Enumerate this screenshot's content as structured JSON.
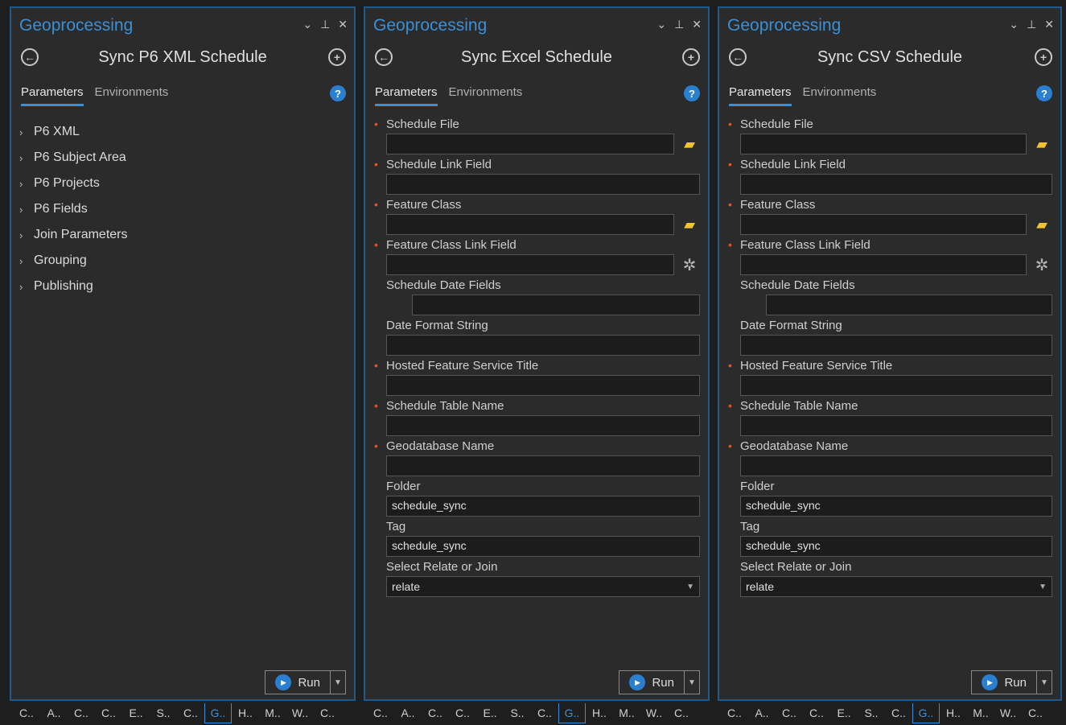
{
  "panes": [
    {
      "title": "Geoprocessing",
      "controls": [
        "⌄",
        "⊥",
        "✕"
      ],
      "tool_title": "Sync P6 XML Schedule",
      "tabs": [
        {
          "label": "Parameters",
          "active": true
        },
        {
          "label": "Environments",
          "active": false
        }
      ],
      "groups": [
        "P6 XML",
        "P6 Subject Area",
        "P6 Projects",
        "P6 Fields",
        "Join Parameters",
        "Grouping",
        "Publishing"
      ],
      "run_label": "Run"
    },
    {
      "title": "Geoprocessing",
      "controls": [
        "⌄",
        "⊥",
        "✕"
      ],
      "tool_title": "Sync Excel Schedule",
      "tabs": [
        {
          "label": "Parameters",
          "active": true
        },
        {
          "label": "Environments",
          "active": false
        }
      ],
      "params": [
        {
          "label": "Schedule File",
          "required": true,
          "value": "",
          "icon": "folder-icon"
        },
        {
          "label": "Schedule Link Field",
          "required": true,
          "value": ""
        },
        {
          "label": "Feature Class",
          "required": true,
          "value": "",
          "icon": "folder-icon"
        },
        {
          "label": "Feature Class Link Field",
          "required": true,
          "value": "",
          "icon": "gear-icon"
        },
        {
          "label": "Schedule Date Fields",
          "required": false,
          "value": "",
          "indent": true
        },
        {
          "label": "Date Format String",
          "required": false,
          "value": ""
        },
        {
          "label": "Hosted Feature Service Title",
          "required": true,
          "value": ""
        },
        {
          "label": "Schedule Table Name",
          "required": true,
          "value": ""
        },
        {
          "label": "Geodatabase Name",
          "required": true,
          "value": ""
        },
        {
          "label": "Folder",
          "required": false,
          "value": "schedule_sync"
        },
        {
          "label": "Tag",
          "required": false,
          "value": "schedule_sync"
        },
        {
          "label": "Select Relate or Join",
          "required": false,
          "value": "relate",
          "select": true
        }
      ],
      "run_label": "Run"
    },
    {
      "title": "Geoprocessing",
      "controls": [
        "⌄",
        "⊥",
        "✕"
      ],
      "tool_title": "Sync CSV Schedule",
      "tabs": [
        {
          "label": "Parameters",
          "active": true
        },
        {
          "label": "Environments",
          "active": false
        }
      ],
      "params": [
        {
          "label": "Schedule File",
          "required": true,
          "value": "",
          "icon": "folder-icon"
        },
        {
          "label": "Schedule Link Field",
          "required": true,
          "value": ""
        },
        {
          "label": "Feature Class",
          "required": true,
          "value": "",
          "icon": "folder-icon"
        },
        {
          "label": "Feature Class Link Field",
          "required": true,
          "value": "",
          "icon": "gear-icon"
        },
        {
          "label": "Schedule Date Fields",
          "required": false,
          "value": "",
          "indent": true
        },
        {
          "label": "Date Format String",
          "required": false,
          "value": ""
        },
        {
          "label": "Hosted Feature Service Title",
          "required": true,
          "value": ""
        },
        {
          "label": "Schedule Table Name",
          "required": true,
          "value": ""
        },
        {
          "label": "Geodatabase Name",
          "required": true,
          "value": ""
        },
        {
          "label": "Folder",
          "required": false,
          "value": "schedule_sync"
        },
        {
          "label": "Tag",
          "required": false,
          "value": "schedule_sync"
        },
        {
          "label": "Select Relate or Join",
          "required": false,
          "value": "relate",
          "select": true
        }
      ],
      "run_label": "Run"
    }
  ],
  "bottom_tabs": [
    "C..",
    "A..",
    "C..",
    "C..",
    "E..",
    "S..",
    "C..",
    "G..",
    "H..",
    "M..",
    "W..",
    "C.."
  ],
  "bottom_active_index": 7,
  "icons": {
    "back": "back-arrow-icon",
    "add": "add-icon",
    "help": "help-icon",
    "folder": "folder-icon",
    "gear": "gear-icon",
    "run": "run-play-icon",
    "chevron": "chevron-right-icon",
    "dropdown": "dropdown-caret-icon"
  },
  "colors": {
    "accent": "#3b8fd6",
    "pane_border": "#1f5a8a",
    "background": "#2b2b2b",
    "required_marker": "#e0552b",
    "folder": "#f2c232"
  }
}
